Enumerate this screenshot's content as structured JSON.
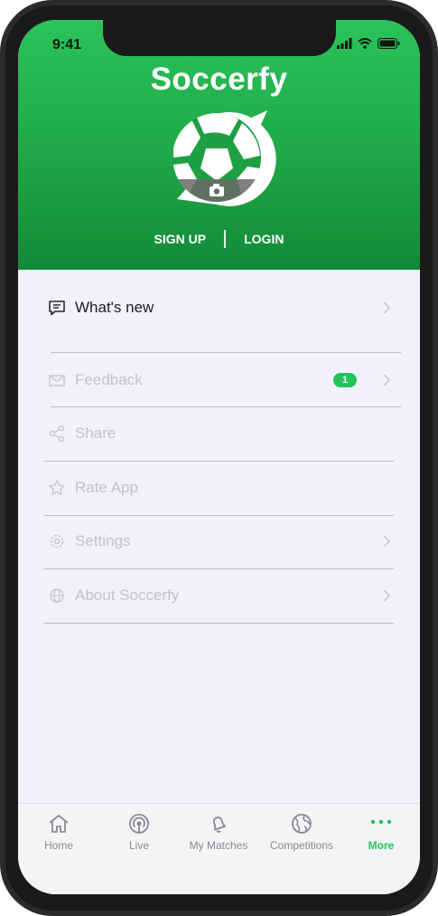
{
  "status_bar": {
    "time": "9:41"
  },
  "app": {
    "name": "Soccerfy"
  },
  "auth": {
    "signup": "SIGN UP",
    "login": "LOGIN"
  },
  "menu": {
    "items": [
      {
        "label": "What's new",
        "icon": "chat-bubble-icon",
        "active": true,
        "chevron": true
      },
      {
        "label": "Feedback",
        "icon": "envelope-icon",
        "badge": "1",
        "chevron": true
      },
      {
        "label": "Share",
        "icon": "share-icon",
        "chevron": false
      },
      {
        "label": "Rate App",
        "icon": "star-icon",
        "chevron": false
      },
      {
        "label": "Settings",
        "icon": "gear-icon",
        "chevron": true
      },
      {
        "label": "About Soccerfy",
        "icon": "globe-icon",
        "chevron": true
      }
    ]
  },
  "tabbar": {
    "tabs": [
      {
        "label": "Home",
        "icon": "home-icon"
      },
      {
        "label": "Live",
        "icon": "broadcast-icon"
      },
      {
        "label": "My Matches",
        "icon": "bell-icon"
      },
      {
        "label": "Competitions",
        "icon": "globe-icon"
      },
      {
        "label": "More",
        "icon": "more-dots-icon",
        "active": true
      }
    ]
  },
  "colors": {
    "brand_green": "#23c25b",
    "header_dark": "#138a37",
    "background": "#f1f1fb"
  }
}
